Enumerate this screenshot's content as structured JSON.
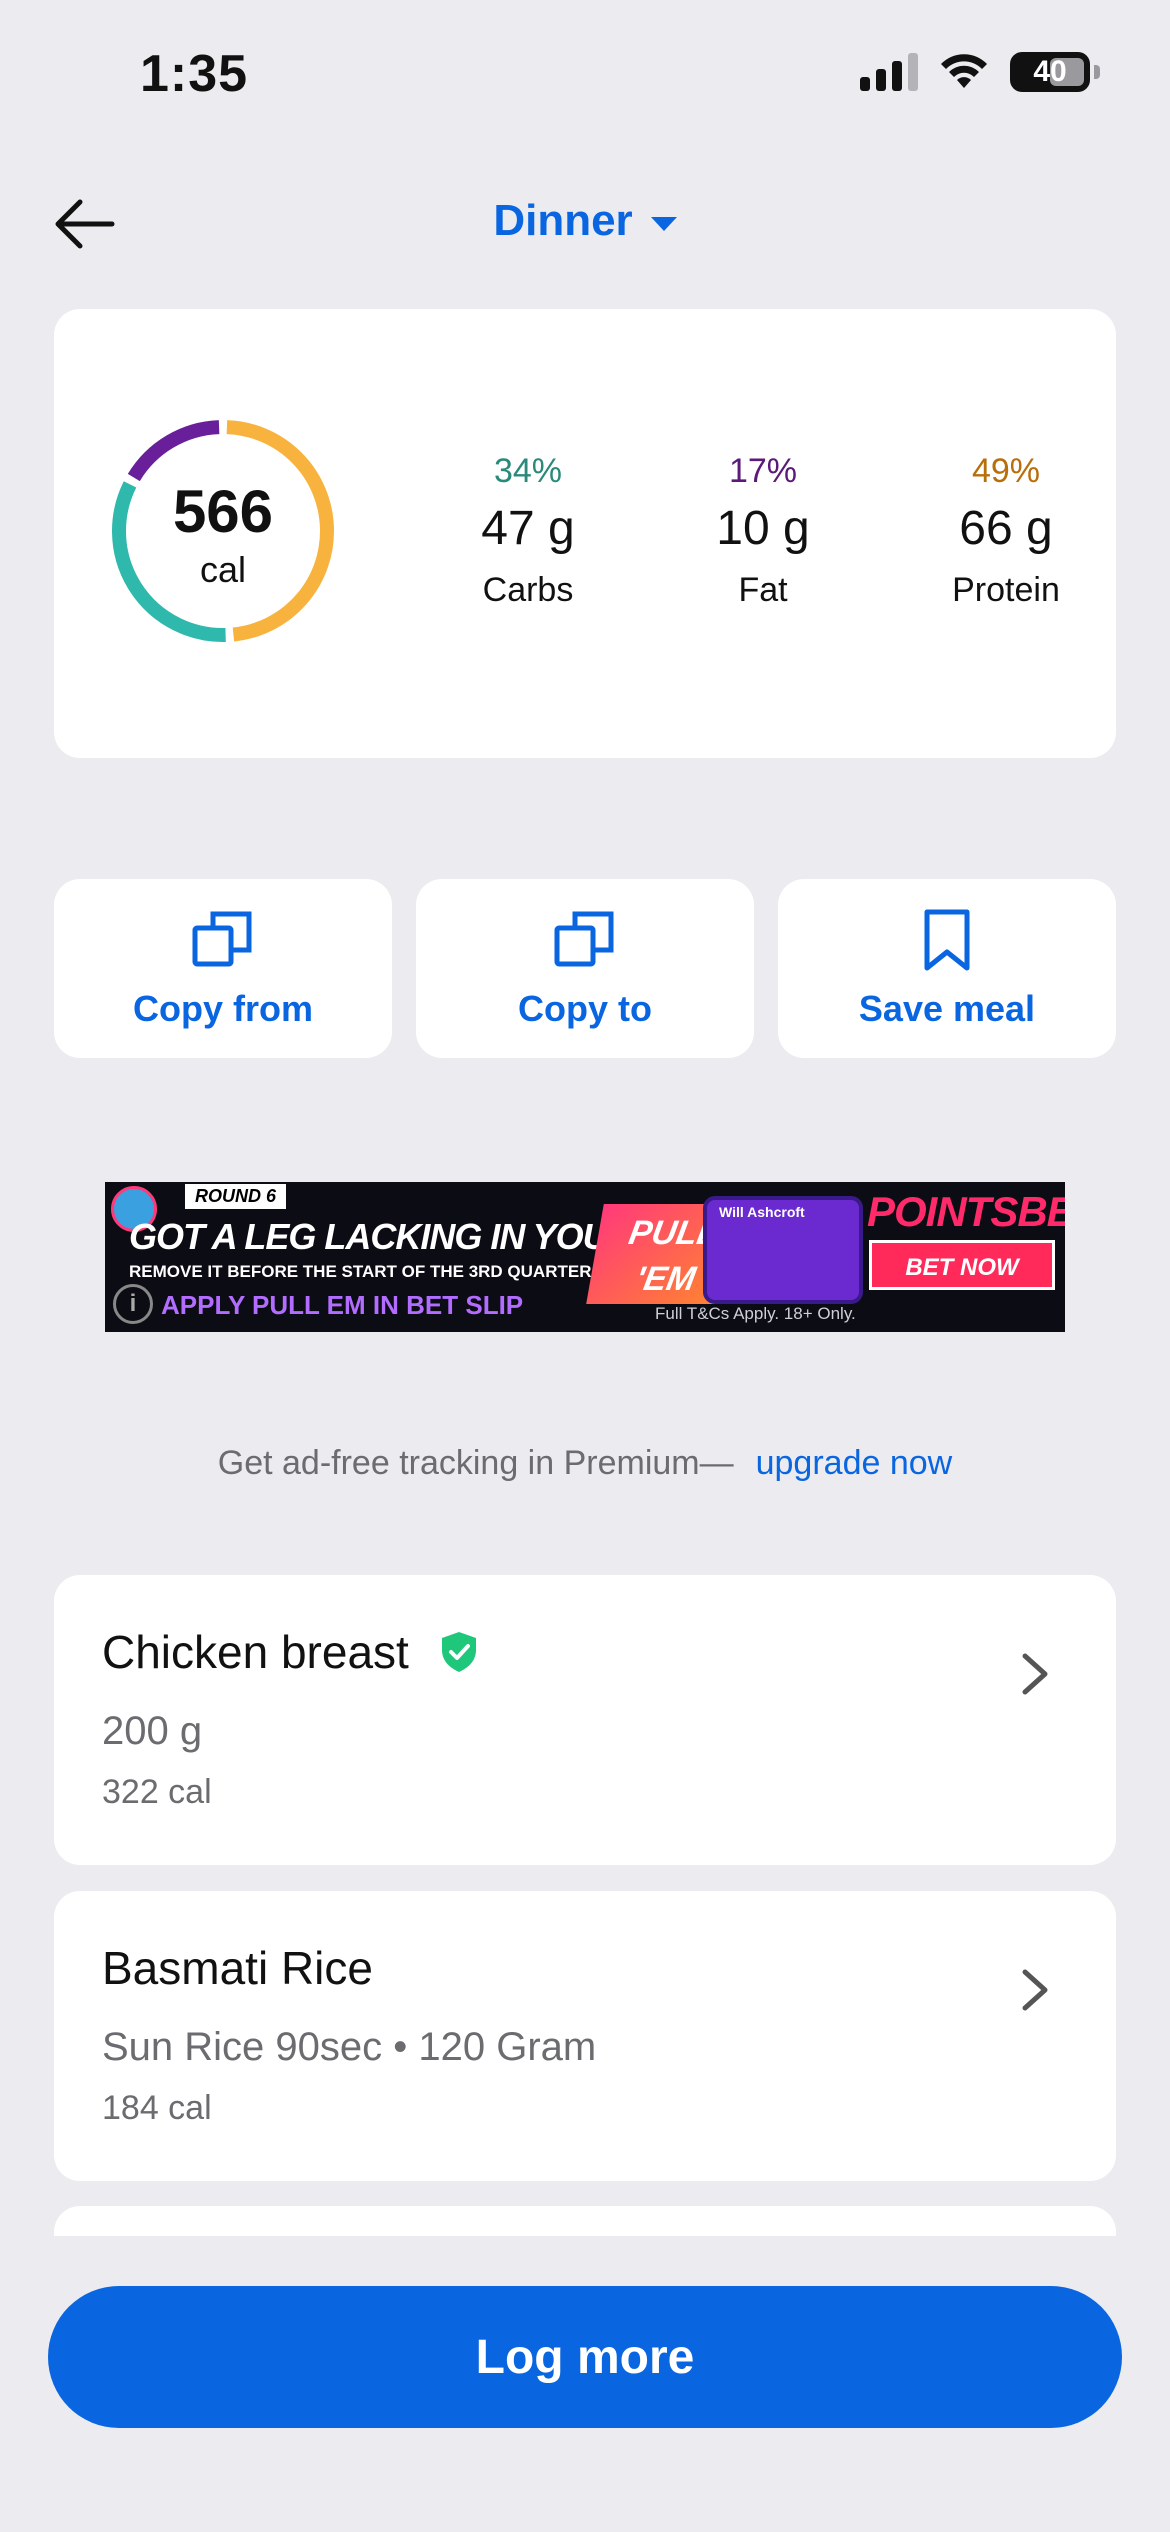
{
  "status_bar": {
    "time": "1:35",
    "battery": "40"
  },
  "header": {
    "meal": "Dinner"
  },
  "summary": {
    "calories": "566",
    "calories_unit": "cal",
    "ring_fractions": {
      "carbs": 0.34,
      "fat": 0.17,
      "protein": 0.49
    },
    "macros": [
      {
        "pct": "34%",
        "grams": "47 g",
        "name": "Carbs",
        "color": "#2a8a7a"
      },
      {
        "pct": "17%",
        "grams": "10 g",
        "name": "Fat",
        "color": "#5b1a7a"
      },
      {
        "pct": "49%",
        "grams": "66 g",
        "name": "Protein",
        "color": "#b86e0a"
      }
    ],
    "colors": {
      "carbs": "#2fb8ac",
      "fat": "#6a1f9a",
      "protein": "#f8b33e"
    }
  },
  "actions": [
    {
      "label": "Copy from",
      "icon": "copy-icon"
    },
    {
      "label": "Copy to",
      "icon": "copy-icon"
    },
    {
      "label": "Save meal",
      "icon": "bookmark-icon"
    }
  ],
  "ad": {
    "round": "ROUND 6",
    "headline": "GOT A LEG LACKING IN YOUR SGM?",
    "subline": "REMOVE IT BEFORE THE START OF THE 3RD QUARTER",
    "apply": "APPLY PULL EM IN BET SLIP",
    "pull": "PULL 'EM",
    "player": "Will Ashcroft",
    "brand": "POINTSBET",
    "cta": "BET NOW",
    "terms": "Full T&Cs Apply. 18+ Only."
  },
  "premium": {
    "text": "Get ad-free tracking in Premium—",
    "link": "upgrade now"
  },
  "foods": [
    {
      "name": "Chicken breast",
      "verified": true,
      "detail": "200 g",
      "calories": "322 cal"
    },
    {
      "name": "Basmati Rice",
      "verified": false,
      "detail": "Sun Rice 90sec • 120 Gram",
      "calories": "184 cal"
    }
  ],
  "log_more": "Log more"
}
